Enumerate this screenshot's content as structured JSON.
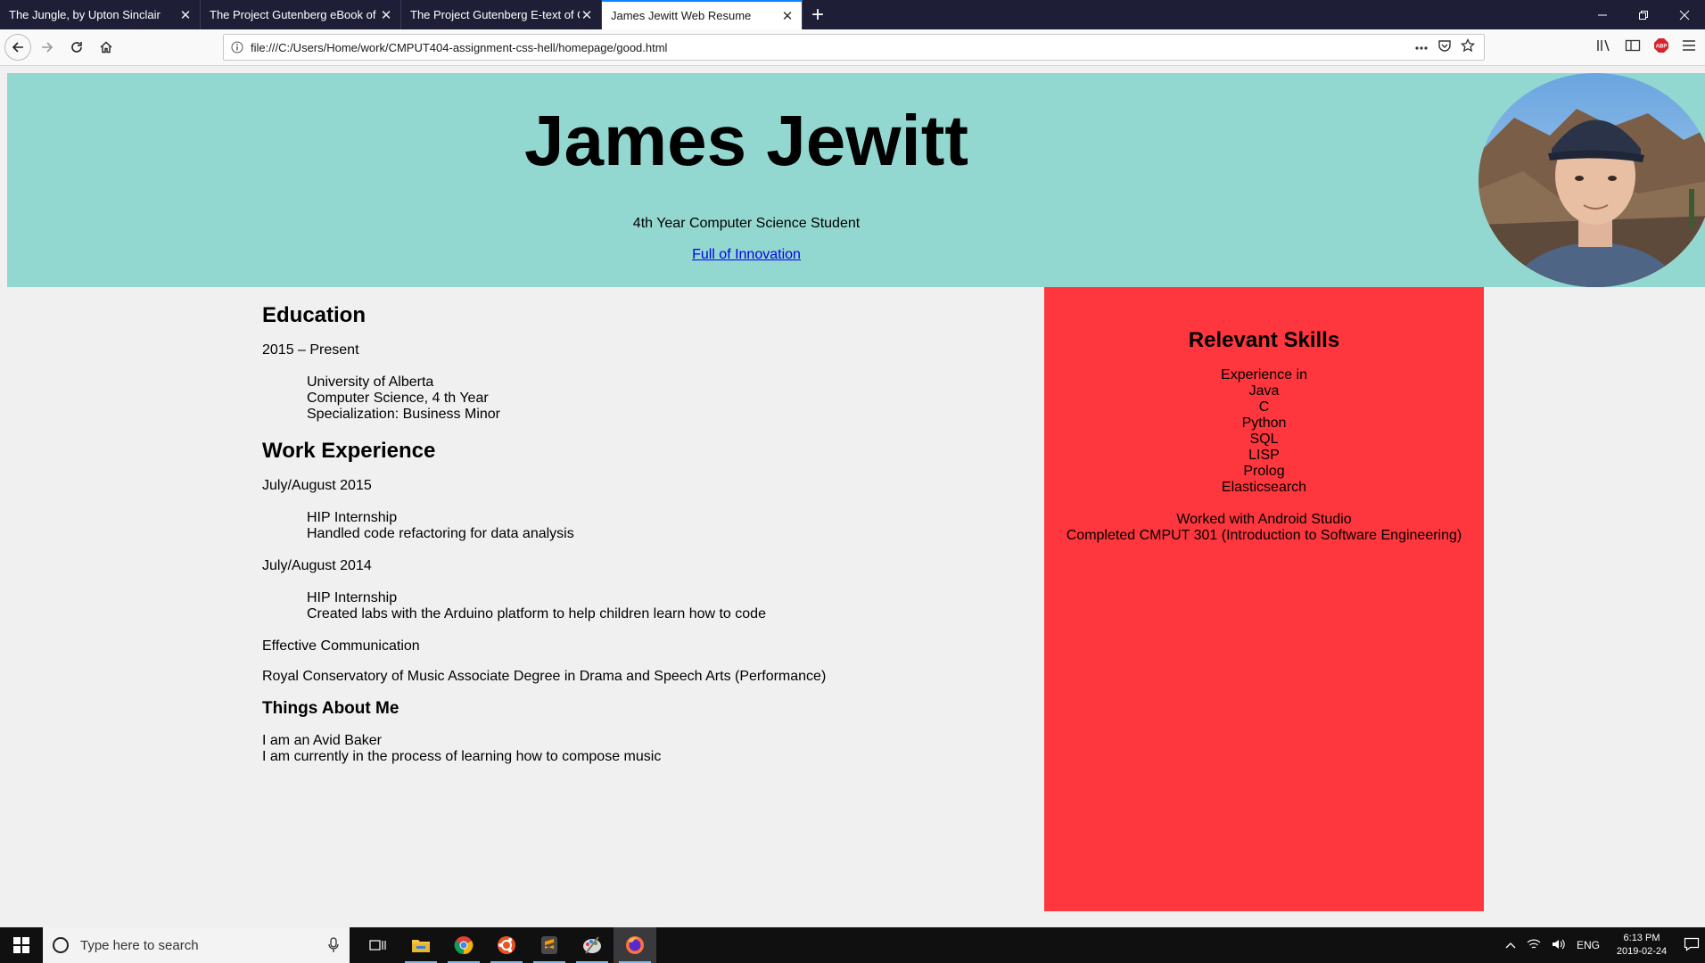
{
  "browser": {
    "tabs": [
      {
        "title": "The Jungle, by Upton Sinclair"
      },
      {
        "title": "The Project Gutenberg eBook of Dr"
      },
      {
        "title": "The Project Gutenberg E-text of Oli"
      },
      {
        "title": "James Jewitt Web Resume"
      }
    ],
    "url": "file:///C:/Users/Home/work/CMPUT404-assignment-css-hell/homepage/good.html"
  },
  "page": {
    "header": {
      "name": "James Jewitt",
      "subtitle": "4th Year Computer Science Student",
      "link_text": "Full of Innovation"
    },
    "education": {
      "heading": "Education",
      "period": "2015 – Present",
      "lines": [
        "University of Alberta",
        "Computer Science, 4 th Year",
        "Specialization: Business Minor"
      ]
    },
    "work": {
      "heading": "Work Experience",
      "jobs": [
        {
          "period": "July/August 2015",
          "lines": [
            "HIP Internship",
            "Handled code refactoring for data analysis"
          ]
        },
        {
          "period": "July/August 2014",
          "lines": [
            "HIP Internship",
            "Created labs with the Arduino platform to help children learn how to code"
          ]
        }
      ],
      "extra": [
        "Effective Communication",
        "Royal Conservatory of Music Associate Degree in Drama and Speech Arts (Performance)"
      ]
    },
    "about": {
      "heading": "Things About Me",
      "lines": [
        "I am an Avid Baker",
        "I am currently in the process of learning how to compose music"
      ]
    },
    "skills": {
      "heading": "Relevant Skills",
      "intro": "Experience in",
      "items": [
        "Java",
        "C",
        "Python",
        "SQL",
        "LISP",
        "Prolog",
        "Elasticsearch"
      ],
      "extra": [
        "Worked with Android Studio",
        "Completed CMPUT 301 (Introduction to Software Engineering)"
      ]
    }
  },
  "taskbar": {
    "search_placeholder": "Type here to search",
    "language": "ENG",
    "time": "6:13 PM",
    "date": "2019-02-24"
  },
  "colors": {
    "header_bg": "#93d8d0",
    "skills_bg": "#fe363d",
    "page_bg": "#f0f0f0",
    "tabbar_bg": "#1e1f36"
  }
}
